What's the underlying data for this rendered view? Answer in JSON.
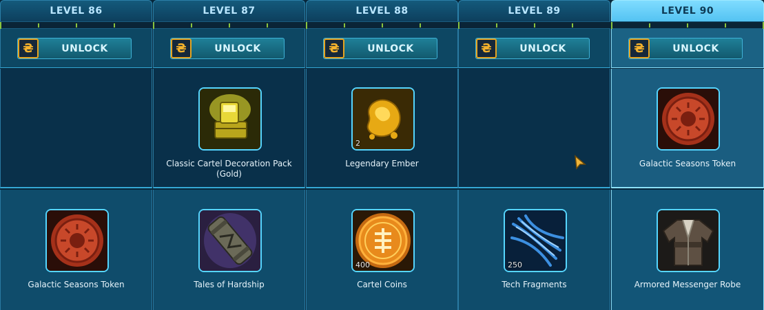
{
  "levels": [
    {
      "label": "LEVEL 86"
    },
    {
      "label": "LEVEL 87"
    },
    {
      "label": "LEVEL 88"
    },
    {
      "label": "LEVEL 89"
    },
    {
      "label": "LEVEL 90"
    }
  ],
  "unlock_label": "UNLOCK",
  "unlock_icon": "cartel-coin-icon",
  "rewards": {
    "c0_top": {
      "label": ""
    },
    "c0_bot": {
      "label": "Galactic Seasons Token",
      "icon": "seasons-token-icon"
    },
    "c1_top": {
      "label": "Classic Cartel Decoration Pack (Gold)",
      "icon": "decoration-pack-icon"
    },
    "c1_bot": {
      "label": "Tales of Hardship",
      "icon": "scroll-icon"
    },
    "c2_top": {
      "label": "Legendary Ember",
      "icon": "ember-icon",
      "qty": "2"
    },
    "c2_bot": {
      "label": "Cartel Coins",
      "icon": "cartel-coins-icon",
      "qty": "400"
    },
    "c3_top": {
      "label": ""
    },
    "c3_bot": {
      "label": "Tech Fragments",
      "icon": "tech-fragments-icon",
      "qty": "250"
    },
    "c4_top": {
      "label": "Galactic Seasons Token",
      "icon": "seasons-token-icon"
    },
    "c4_bot": {
      "label": "Armored Messenger Robe",
      "icon": "robe-icon"
    }
  },
  "colors": {
    "accent": "#56d6ff",
    "progress": "#8ac43f",
    "coin": "#f3b12c",
    "active_header": "#7fdcff"
  }
}
